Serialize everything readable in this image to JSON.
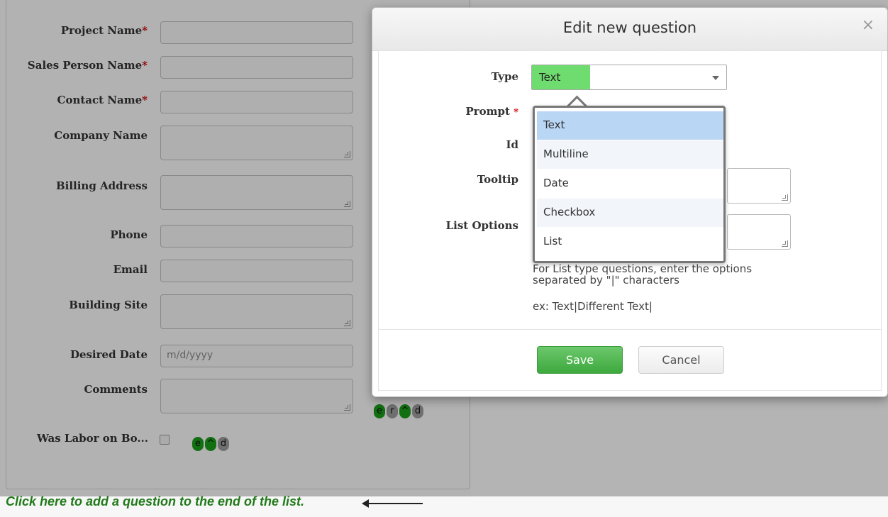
{
  "form": {
    "fields": [
      {
        "label": "Project Name",
        "required": true
      },
      {
        "label": "Sales Person Name",
        "required": true
      },
      {
        "label": "Contact Name",
        "required": true
      },
      {
        "label": "Company Name",
        "required": false
      },
      {
        "label": "Billing Address",
        "required": false
      },
      {
        "label": "Phone",
        "required": false
      },
      {
        "label": "Email",
        "required": false
      },
      {
        "label": "Building Site",
        "required": false
      },
      {
        "label": "Desired Date",
        "required": false,
        "placeholder": "m/d/yyyy"
      },
      {
        "label": "Comments",
        "required": false
      },
      {
        "label": "Was Labor on Bo...",
        "required": false
      }
    ],
    "required_mark": "*",
    "pill_row_1": [
      "e",
      "r",
      "^",
      "d"
    ],
    "pill_row_2": [
      "e",
      "^",
      "d"
    ]
  },
  "footer": {
    "add_link": "Click here to add a question to the end of the list."
  },
  "modal": {
    "title": "Edit new question",
    "close_glyph": "×",
    "labels": {
      "type": "Type",
      "prompt": "Prompt",
      "id": "Id",
      "tooltip": "Tooltip",
      "list_options": "List Options"
    },
    "type_selected": "Text",
    "type_options": [
      "Text",
      "Multiline",
      "Date",
      "Checkbox",
      "List"
    ],
    "help_text": "For List type questions, enter the options separated by \"|\" characters",
    "example_text": "ex: Text|Different Text|",
    "save_label": "Save",
    "cancel_label": "Cancel"
  },
  "colors": {
    "accent_green": "#3ea83e",
    "link_green": "#217a1a",
    "required_red": "#cc0000",
    "selected_option": "#b9d6f5"
  }
}
